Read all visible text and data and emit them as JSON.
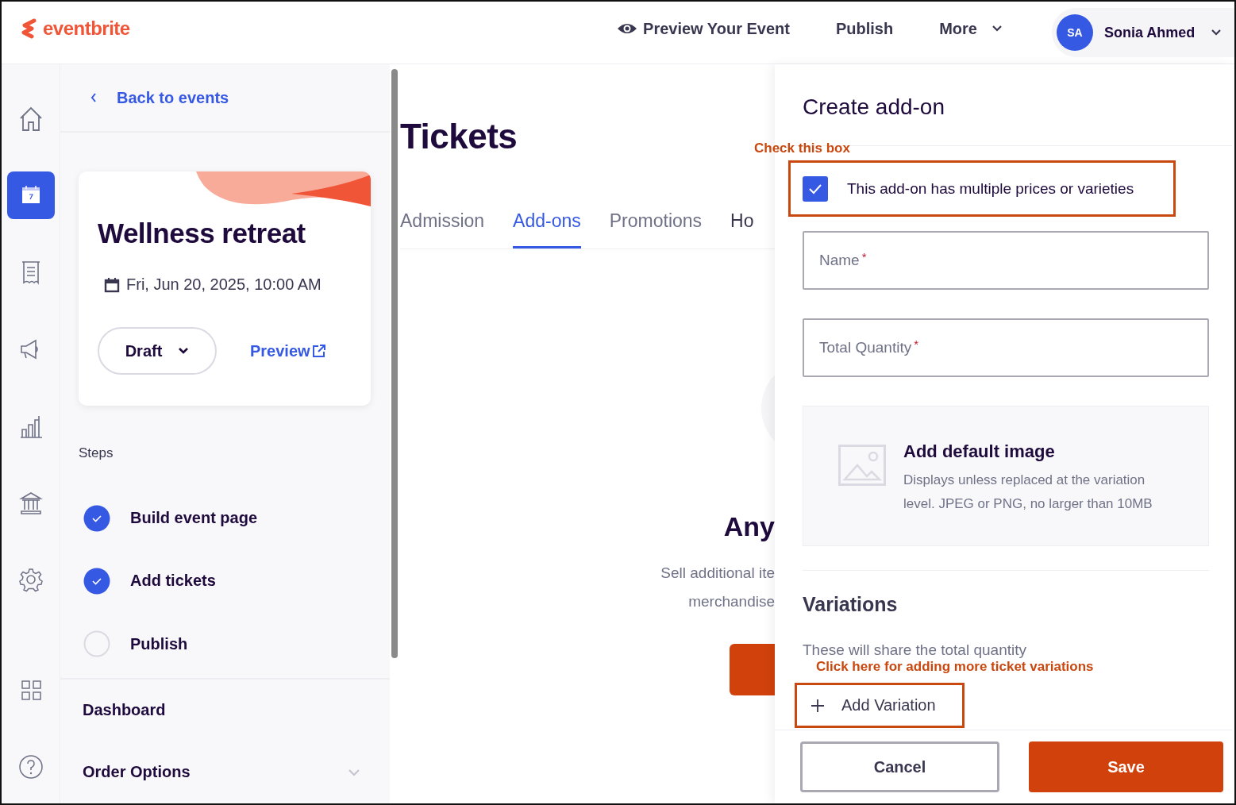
{
  "header": {
    "logo": "eventbrite",
    "actions": [
      {
        "kind": "preview",
        "label": "Preview Your Event"
      },
      {
        "kind": "link",
        "label": "Publish"
      },
      {
        "kind": "menu",
        "label": "More"
      }
    ],
    "user": {
      "initials": "SA",
      "name": "Sonia Ahmed"
    }
  },
  "rail": {
    "items": [
      {
        "kind": "home",
        "selected": false
      },
      {
        "kind": "calendar",
        "selected": true
      },
      {
        "kind": "receipt",
        "selected": false
      },
      {
        "kind": "megaphone",
        "selected": false
      },
      {
        "kind": "chart",
        "selected": false
      },
      {
        "kind": "bank",
        "selected": false
      },
      {
        "kind": "settings",
        "selected": false
      },
      {
        "kind": "apps",
        "selected": false
      },
      {
        "kind": "help",
        "selected": false
      }
    ]
  },
  "panel": {
    "back": "Back to events",
    "event": {
      "title": "Wellness retreat",
      "date": "Fri, Jun 20, 2025, 10:00 AM",
      "status": "Draft",
      "preview": "Preview"
    },
    "steps_label": "Steps",
    "steps": [
      {
        "label": "Build event page",
        "checked": true
      },
      {
        "label": "Add tickets",
        "checked": true
      },
      {
        "label": "Publish",
        "checked": false
      }
    ],
    "sections": [
      {
        "label": "Dashboard",
        "expandable": false
      },
      {
        "label": "Order Options",
        "expandable": true
      }
    ]
  },
  "main": {
    "title": "Tickets",
    "tabs": [
      {
        "label": "Admission",
        "selected": false
      },
      {
        "label": "Add-ons",
        "selected": true
      },
      {
        "label": "Promotions",
        "selected": false
      },
      {
        "label": "Ho",
        "selected": false
      }
    ],
    "empty": {
      "heading": "Any",
      "lines": [
        "Sell additional ite",
        "merchandise"
      ]
    }
  },
  "drawer": {
    "title": "Create add-on",
    "multiple": {
      "label": "This add-on has multiple prices or varieties",
      "checked": true
    },
    "fields": [
      {
        "label": "Name",
        "required_mark": "*"
      },
      {
        "label": "Total Quantity",
        "required_mark": "*"
      }
    ],
    "image": {
      "title": "Add default image",
      "description": "Displays unless replaced at the variation level. JPEG or PNG, no larger than 10MB"
    },
    "variations": {
      "title": "Variations",
      "hint": "These will share the total quantity",
      "add": "Add Variation"
    },
    "buttons": [
      {
        "kind": "secondary",
        "label": "Cancel"
      },
      {
        "kind": "primary",
        "label": "Save"
      }
    ]
  },
  "annotations": [
    {
      "text": "Check this box"
    },
    {
      "text": "Click here for adding more ticket variations"
    }
  ]
}
